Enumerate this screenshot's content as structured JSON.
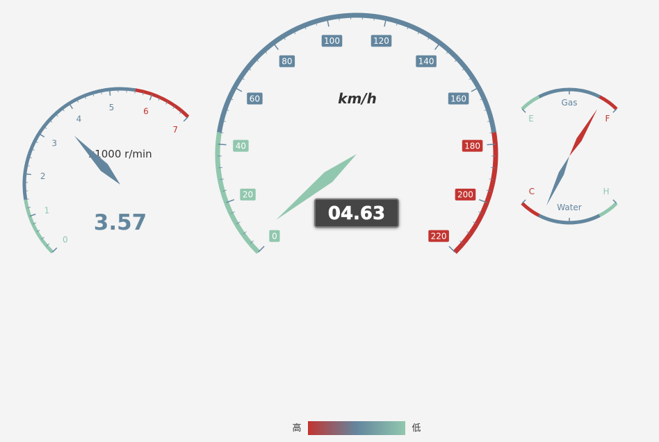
{
  "colors": {
    "high": "#c23531",
    "mid": "#63869e",
    "low": "#91c7ae",
    "background": "#f4f4f4",
    "detail_bg": "#444444",
    "detail_border": "#777777",
    "detail_text": "#ffffff",
    "title_text": "#333333"
  },
  "chart_data": [
    {
      "type": "gauge",
      "name": "speed",
      "title": "km/h",
      "min": 0,
      "max": 220,
      "split_number": 11,
      "value": 4.63,
      "detail": "04.63",
      "axis_bands": [
        {
          "to": 0.2,
          "color": "#91c7ae"
        },
        {
          "to": 0.8,
          "color": "#63869e"
        },
        {
          "to": 1.0,
          "color": "#c23531"
        }
      ],
      "tick_labels": [
        "0",
        "20",
        "40",
        "60",
        "80",
        "100",
        "120",
        "140",
        "160",
        "180",
        "200",
        "220"
      ]
    },
    {
      "type": "gauge",
      "name": "rpm",
      "title": "x1000 r/min",
      "min": 0,
      "max": 7,
      "split_number": 7,
      "value": 3.57,
      "detail": "3.57",
      "axis_bands": [
        {
          "to": 0.2,
          "color": "#91c7ae"
        },
        {
          "to": 0.8,
          "color": "#63869e"
        },
        {
          "to": 1.0,
          "color": "#c23531"
        }
      ],
      "tick_labels": [
        "0",
        "1",
        "2",
        "3",
        "4",
        "5",
        "6",
        "7"
      ]
    },
    {
      "type": "gauge",
      "name": "fuel",
      "title": "Gas",
      "min": 0,
      "max": 2,
      "value": 1.68,
      "axis_bands": [
        {
          "to": 0.2,
          "color": "#91c7ae"
        },
        {
          "to": 0.8,
          "color": "#63869e"
        },
        {
          "to": 1.0,
          "color": "#c23531"
        }
      ],
      "end_labels": [
        "E",
        "F"
      ]
    },
    {
      "type": "gauge",
      "name": "water",
      "title": "Water",
      "min": 0,
      "max": 2,
      "value": 0.45,
      "axis_bands": [
        {
          "to": 0.2,
          "color": "#c23531"
        },
        {
          "to": 0.8,
          "color": "#63869e"
        },
        {
          "to": 1.0,
          "color": "#91c7ae"
        }
      ],
      "end_labels": [
        "C",
        "H"
      ]
    }
  ],
  "visual_map": {
    "high_label": "高",
    "low_label": "低",
    "gradient": [
      "#c23531",
      "#63869e",
      "#91c7ae"
    ]
  }
}
